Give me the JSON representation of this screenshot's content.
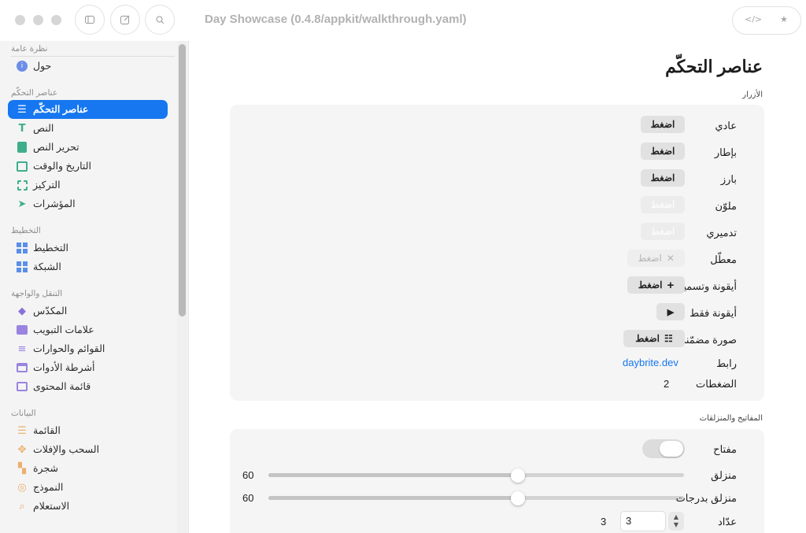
{
  "window": {
    "title": "Day Showcase (0.4.8/appkit/walkthrough.yaml)"
  },
  "toolbar": {
    "sidebar_icon": "sidebar-icon",
    "compose_icon": "square-pencil-icon",
    "search_icon": "search-icon",
    "code_icon": "code-icon",
    "star_icon": "star-icon"
  },
  "sidebar": {
    "sections": [
      {
        "title": "نظرة عامة"
      },
      {
        "title": "عناصر التحكّم"
      },
      {
        "title": "التخطيط"
      },
      {
        "title": "التنقل والواجهة"
      },
      {
        "title": "البيانات"
      }
    ],
    "items": [
      {
        "label": "حول",
        "icon": "info-icon"
      },
      {
        "label": "عناصر التحكّم",
        "icon": "sliders-icon"
      },
      {
        "label": "النص",
        "icon": "text-icon"
      },
      {
        "label": "تحرير النص",
        "icon": "edit-document-icon"
      },
      {
        "label": "التاريخ والوقت",
        "icon": "calendar-icon"
      },
      {
        "label": "التركيز",
        "icon": "focus-icon"
      },
      {
        "label": "المؤشرات",
        "icon": "cursor-icon"
      },
      {
        "label": "التخطيط",
        "icon": "layout-grid-icon"
      },
      {
        "label": "الشبكة",
        "icon": "grid-icon"
      },
      {
        "label": "المكدّس",
        "icon": "stack-icon"
      },
      {
        "label": "علامات التبويب",
        "icon": "tabs-icon"
      },
      {
        "label": "القوائم والحوارات",
        "icon": "menu-icon"
      },
      {
        "label": "أشرطة الأدوات",
        "icon": "toolbar-icon"
      },
      {
        "label": "قائمة المحتوى",
        "icon": "columns-icon"
      },
      {
        "label": "القائمة",
        "icon": "list-icon"
      },
      {
        "label": "السحب والإفلات",
        "icon": "move-icon"
      },
      {
        "label": "شجرة",
        "icon": "tree-icon"
      },
      {
        "label": "النموذج",
        "icon": "database-icon"
      },
      {
        "label": "الاستعلام",
        "icon": "query-icon"
      }
    ],
    "selected_index": 1
  },
  "main": {
    "title": "عناصر التحكّم",
    "buttons_group": {
      "title": "الأزرار",
      "rows": [
        {
          "label": "عادي",
          "button": "اضغط"
        },
        {
          "label": "بإطار",
          "button": "اضغط"
        },
        {
          "label": "بارز",
          "button": "اضغط"
        },
        {
          "label": "ملوّن",
          "button": "اضغط"
        },
        {
          "label": "تدميري",
          "button": "اضغط"
        },
        {
          "label": "معطّل",
          "button": "اضغط"
        },
        {
          "label": "أيقونة وتسمية",
          "button": "اضغط"
        },
        {
          "label": "أيقونة فقط"
        },
        {
          "label": "صورة مضمّنة",
          "button": "اضغط"
        },
        {
          "label": "رابط",
          "link": "daybrite.dev"
        },
        {
          "label": "الضغطات",
          "value": "2"
        }
      ]
    },
    "switches_group": {
      "title": "المفاتيح والمنزلقات",
      "switch_label": "مفتاح",
      "switch_on": true,
      "slider": {
        "label": "منزلق",
        "value": "60",
        "fraction": 0.6
      },
      "stepped_slider": {
        "label": "منزلق بدرجات",
        "value": "60",
        "fraction": 0.6
      },
      "stepper": {
        "label": "عدّاد",
        "value": "3",
        "field_value": "3"
      }
    }
  }
}
